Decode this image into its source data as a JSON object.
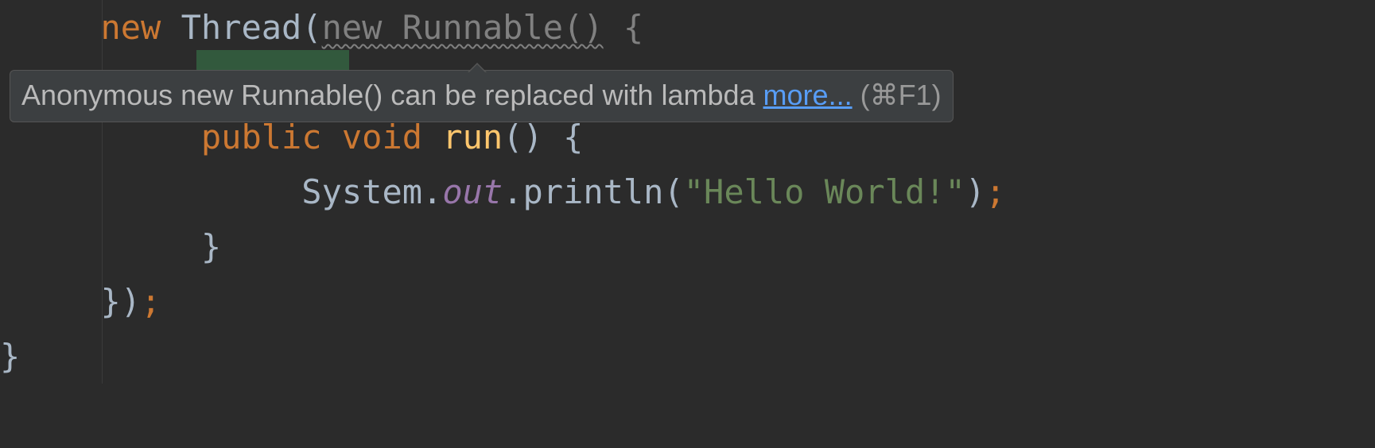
{
  "code": {
    "line1": {
      "kw_new": "new",
      "space1": " ",
      "thread": "Thread",
      "paren_open": "(",
      "warn_new_runnable": "new Runnable()",
      "space2": " ",
      "brace_open": "{"
    },
    "line3": {
      "kw_public": "public",
      "space1": " ",
      "kw_void": "void",
      "space2": " ",
      "method_run": "run",
      "parens": "()",
      "space3": " ",
      "brace_open": "{"
    },
    "line4": {
      "system": "System.",
      "out": "out",
      "print_call": ".println(",
      "string": "\"Hello World!\"",
      "paren_close": ")",
      "semi": ";"
    },
    "line5": {
      "brace_close": "}"
    },
    "line6": {
      "close": "})",
      "semi": ";"
    },
    "line7": {
      "brace_close": "}"
    }
  },
  "tooltip": {
    "message": "Anonymous new Runnable() can be replaced with lambda ",
    "more_link": "more...",
    "shortcut": " (⌘F1)"
  }
}
